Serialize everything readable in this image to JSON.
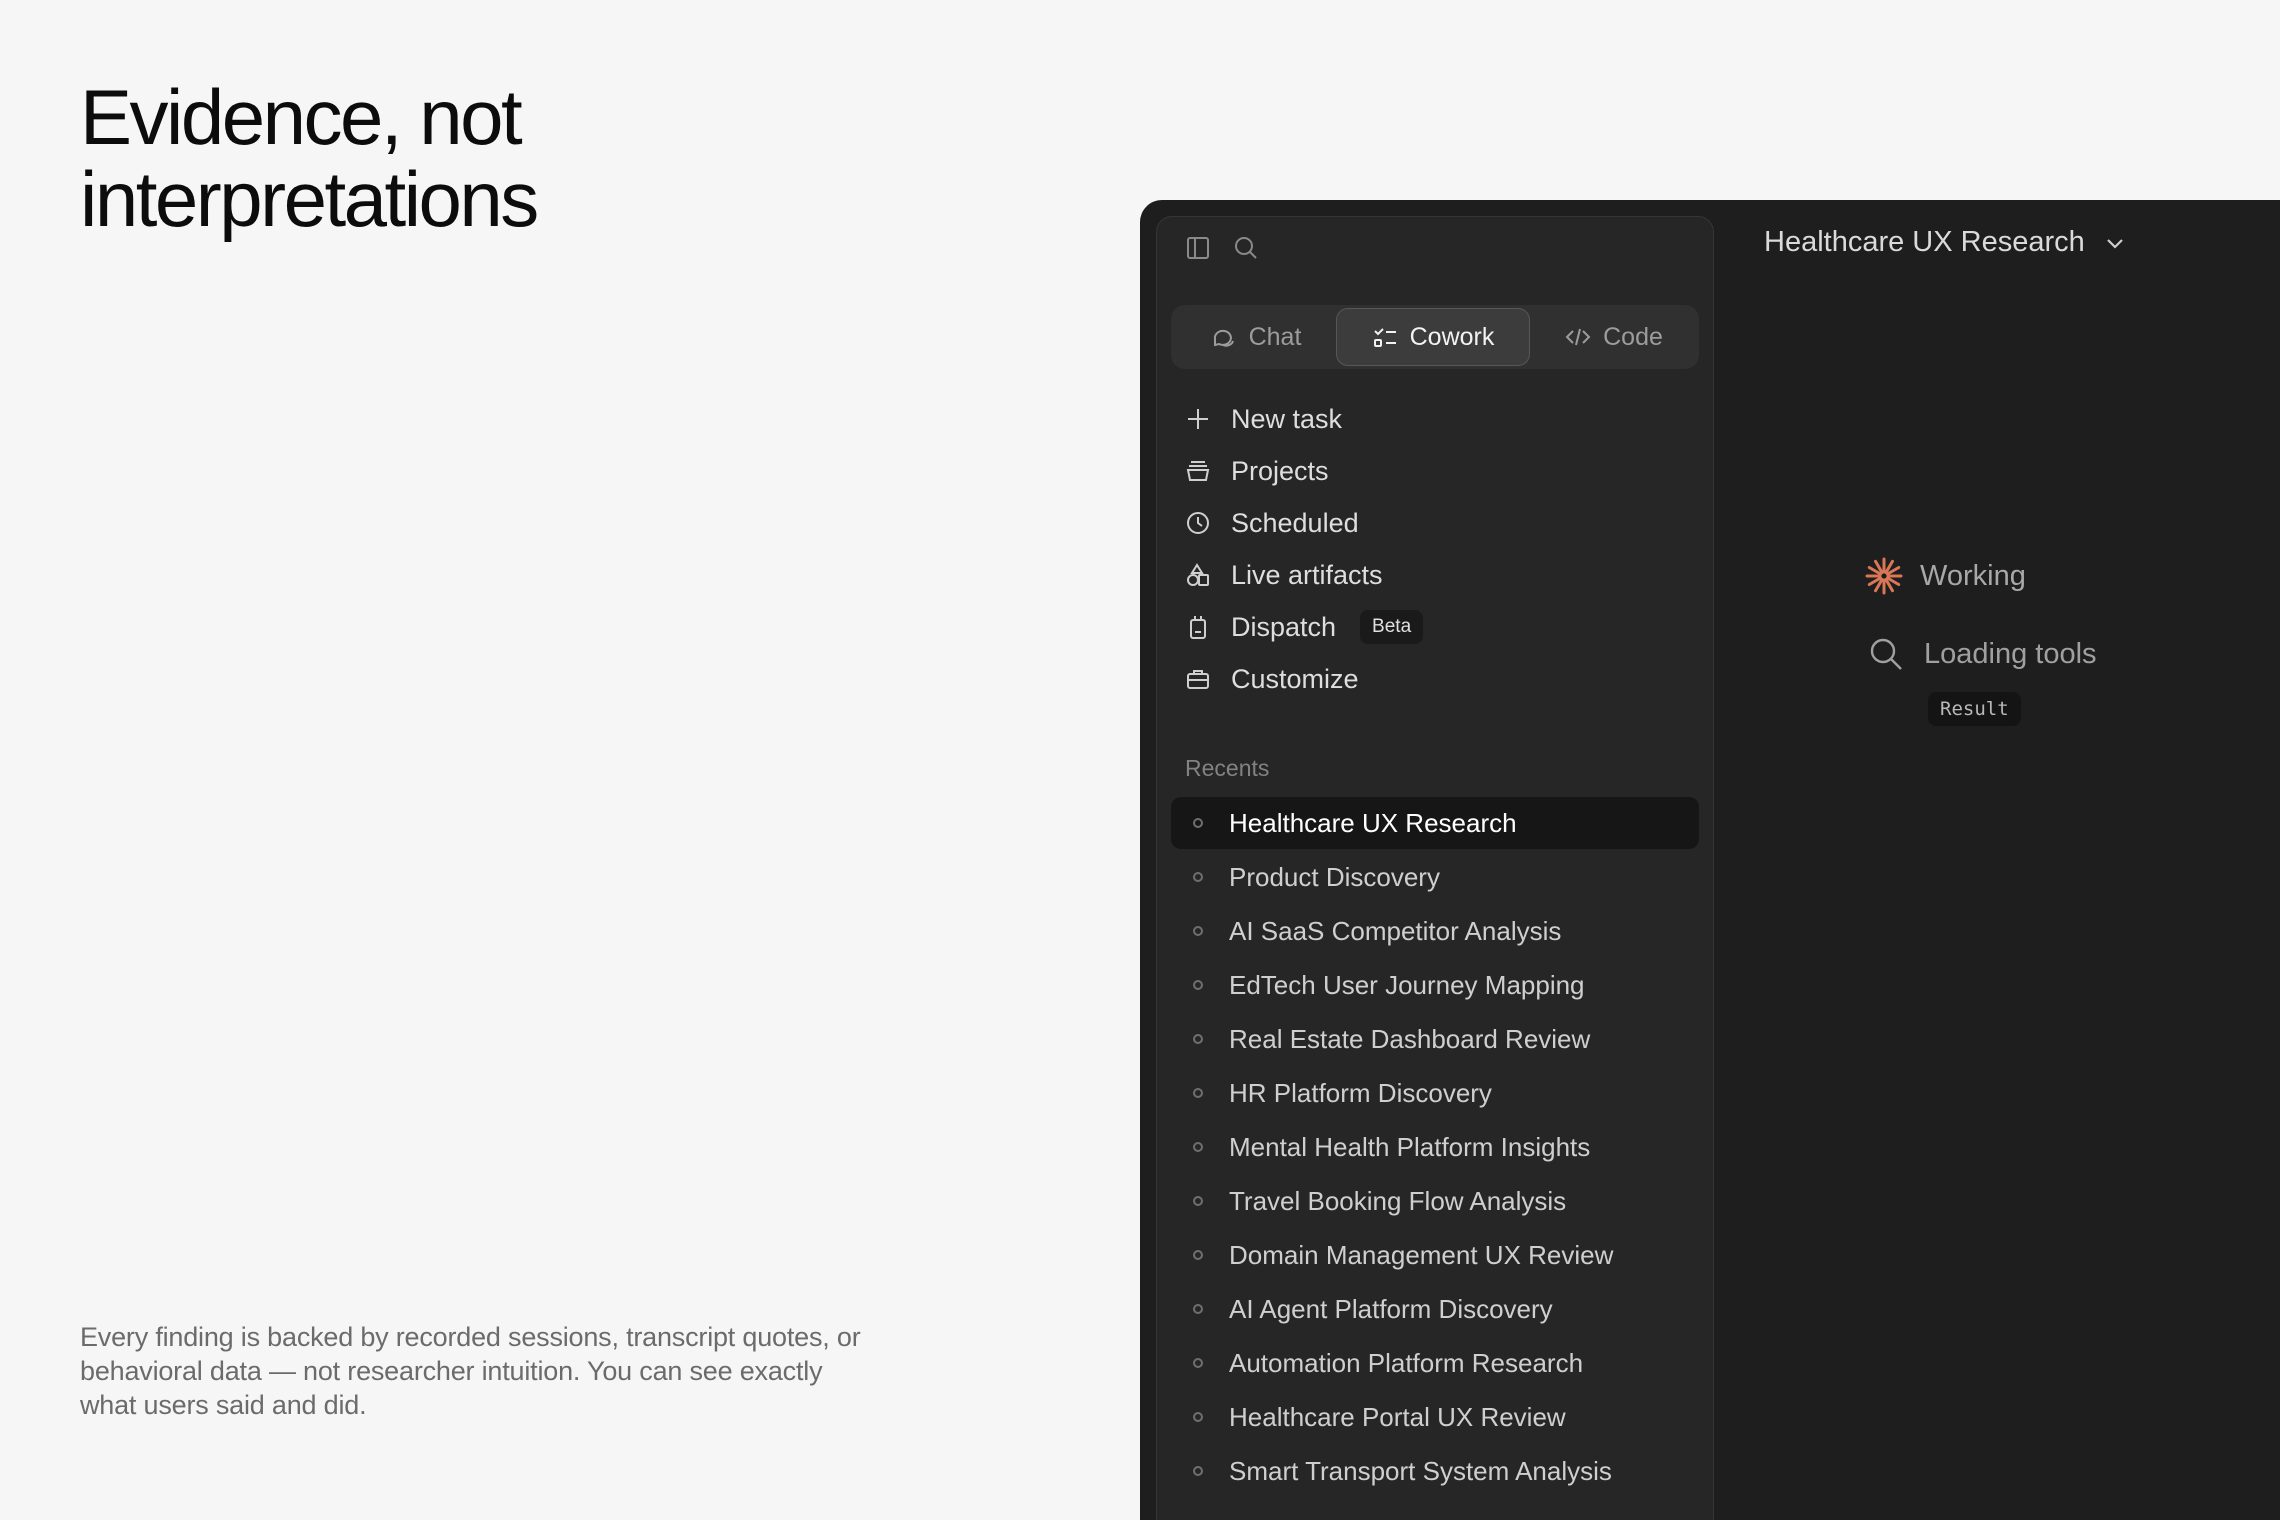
{
  "headline": "Evidence, not interpretations",
  "caption": "Every finding is backed by recorded sessions, transcript quotes, or behavioral data — not researcher intuition. You can see exactly what users said and did.",
  "app": {
    "tabs": [
      {
        "label": "Chat",
        "icon": "chat-bubbles-icon"
      },
      {
        "label": "Cowork",
        "icon": "checklist-icon",
        "active": true
      },
      {
        "label": "Code",
        "icon": "code-icon"
      }
    ],
    "nav": [
      {
        "label": "New task",
        "icon": "plus-icon"
      },
      {
        "label": "Projects",
        "icon": "folder-stack-icon"
      },
      {
        "label": "Scheduled",
        "icon": "clock-icon"
      },
      {
        "label": "Live artifacts",
        "icon": "shapes-icon"
      },
      {
        "label": "Dispatch",
        "icon": "device-icon",
        "badge": "Beta"
      },
      {
        "label": "Customize",
        "icon": "briefcase-icon"
      }
    ],
    "recents_label": "Recents",
    "recents": [
      "Healthcare UX Research",
      "Product Discovery",
      "AI SaaS Competitor Analysis",
      "EdTech User Journey Mapping",
      "Real Estate Dashboard Review",
      "HR Platform Discovery",
      "Mental Health Platform Insights",
      "Travel Booking Flow Analysis",
      "Domain Management UX Review",
      "AI Agent Platform Discovery",
      "Automation Platform Research",
      "Healthcare Portal UX Review",
      "Smart Transport System Analysis"
    ],
    "active_recent": 0,
    "main": {
      "title": "Healthcare UX Research",
      "working_label": "Working",
      "loading_label": "Loading tools",
      "result_label": "Result"
    },
    "colors": {
      "accent": "#d97757"
    }
  }
}
